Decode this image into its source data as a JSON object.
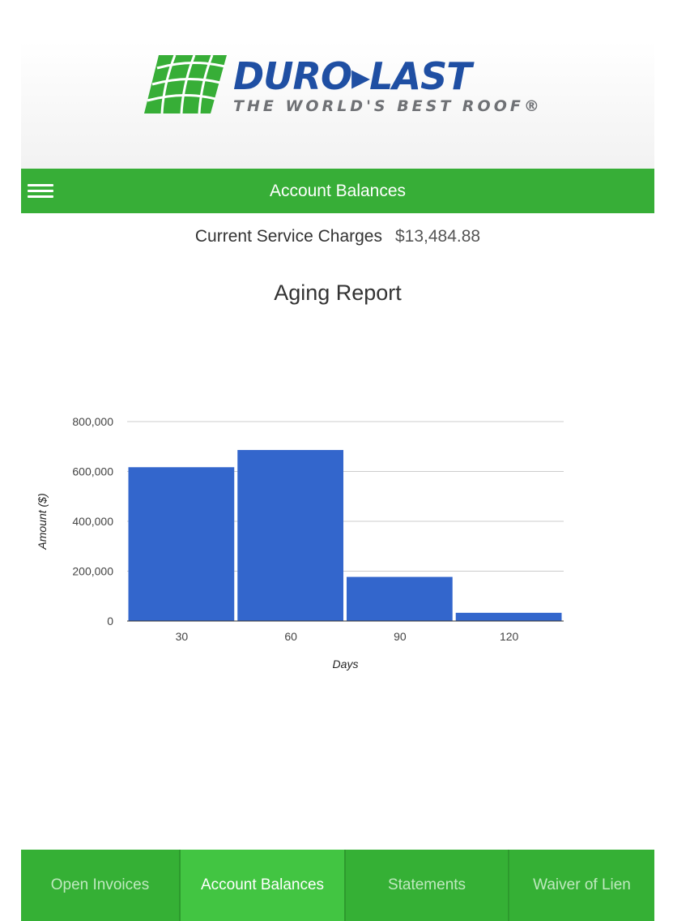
{
  "brand": {
    "wordmark": "DURO▸LAST",
    "tagline": "THE WORLD'S BEST ROOF®",
    "colors": {
      "blue": "#1f4fa3",
      "green": "#37ae37",
      "gray": "#6f7175"
    }
  },
  "header": {
    "title": "Account Balances",
    "menu_icon": "hamburger-menu-icon"
  },
  "summary": {
    "label": "Current Service Charges",
    "value": "$13,484.88"
  },
  "report": {
    "title": "Aging Report"
  },
  "chart_data": {
    "type": "bar",
    "categories": [
      "30",
      "60",
      "90",
      "120"
    ],
    "values": [
      617000,
      686000,
      177000,
      33000
    ],
    "xlabel": "Days",
    "ylabel": "Amount ($)",
    "ylim": [
      0,
      800000
    ],
    "yticks": [
      "0",
      "200,000",
      "400,000",
      "600,000",
      "800,000"
    ],
    "grid": true,
    "bar_color": "#3366cc"
  },
  "tabs": [
    {
      "label": "Open Invoices",
      "active": false
    },
    {
      "label": "Account Balances",
      "active": true
    },
    {
      "label": "Statements",
      "active": false
    },
    {
      "label": "Waiver of Lien",
      "active": false
    }
  ]
}
